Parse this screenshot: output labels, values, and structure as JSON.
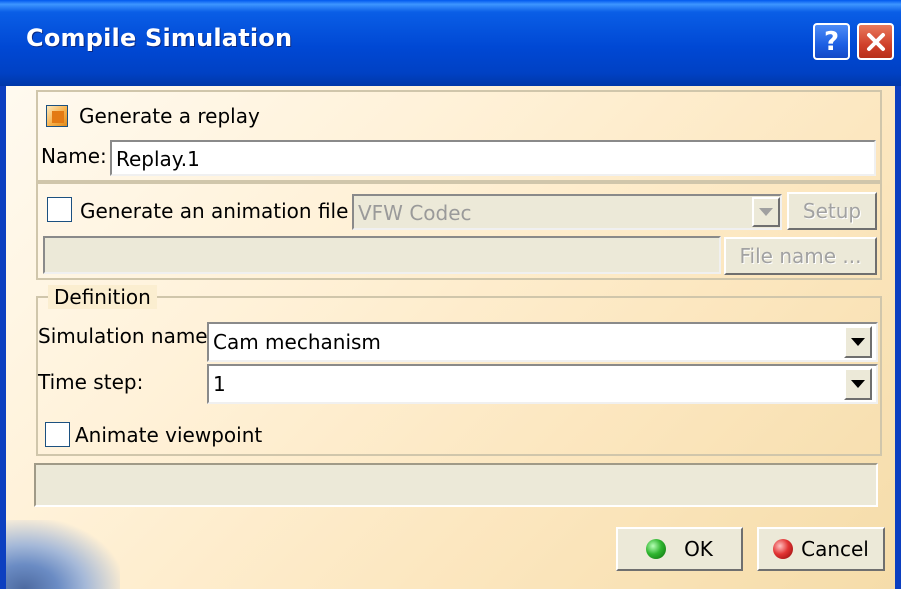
{
  "window": {
    "title": "Compile Simulation",
    "help_label": "?",
    "close_label": "✕"
  },
  "replay": {
    "checkbox_label": "Generate a replay",
    "checked": true,
    "name_label": "Name:",
    "name_value": "Replay.1"
  },
  "animation": {
    "checkbox_label": "Generate an animation file",
    "checked": false,
    "codec_value": "VFW Codec",
    "setup_label": "Setup",
    "file_path_value": "",
    "file_name_label": "File name ..."
  },
  "definition": {
    "group_label": "Definition",
    "simulation_name_label": "Simulation name:",
    "simulation_name_value": "Cam mechanism",
    "time_step_label": "Time step:",
    "time_step_value": "1",
    "animate_viewpoint_label": "Animate viewpoint",
    "animate_viewpoint_checked": false
  },
  "status": {
    "text": ""
  },
  "footer": {
    "ok_label": "OK",
    "cancel_label": "Cancel"
  },
  "colors": {
    "titlebar": "#0048d4",
    "close_button": "#d0402a",
    "ok_icon": "#2fb52f",
    "cancel_icon": "#e23434"
  }
}
